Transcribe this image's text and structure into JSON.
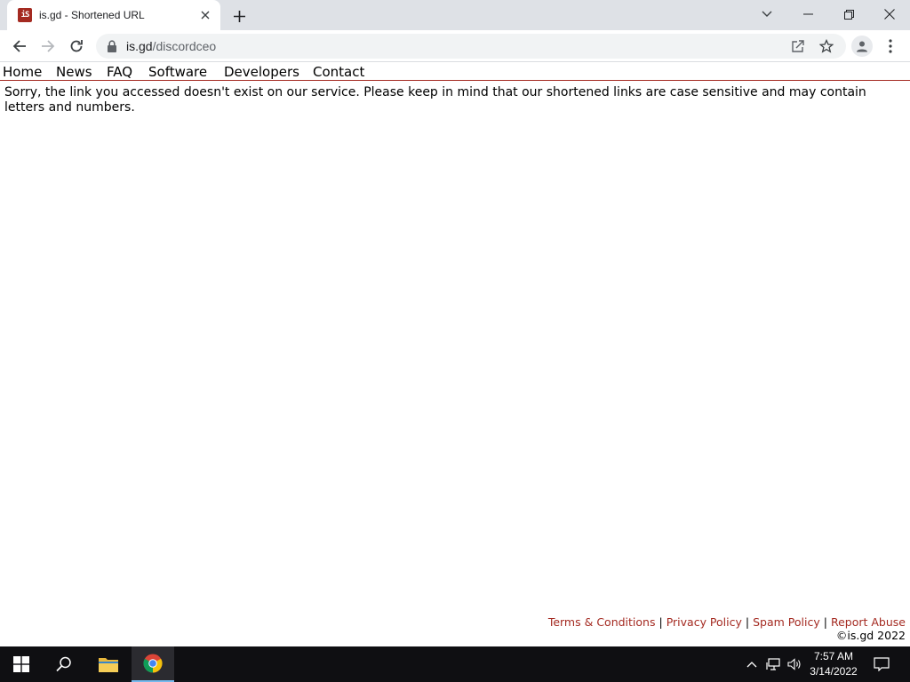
{
  "browser": {
    "tab": {
      "title": "is.gd - Shortened URL",
      "favicon_text": "iS"
    },
    "address": {
      "host": "is.gd",
      "path": "/discordceo"
    },
    "icons": {
      "close_tab": "close-icon",
      "new_tab": "plus-icon",
      "back": "arrow-left-icon",
      "forward": "arrow-right-icon",
      "reload": "reload-icon",
      "lock": "lock-icon",
      "share": "share-icon",
      "bookmark": "star-icon",
      "profile": "person-icon",
      "menu": "kebab-menu-icon"
    }
  },
  "site": {
    "nav": [
      "Home",
      "News",
      "FAQ",
      "Software",
      "Developers",
      "Contact"
    ],
    "message": "Sorry, the link you accessed doesn't exist on our service. Please keep in mind that our shortened links are case sensitive and may contain letters and numbers.",
    "footer": {
      "links": [
        "Terms & Conditions",
        "Privacy Policy",
        "Spam Policy",
        "Report Abuse"
      ],
      "separator": "|",
      "copyright": "©is.gd 2022"
    },
    "accent_color": "#a42a21"
  },
  "taskbar": {
    "time": "7:57 AM",
    "date": "3/14/2022"
  }
}
